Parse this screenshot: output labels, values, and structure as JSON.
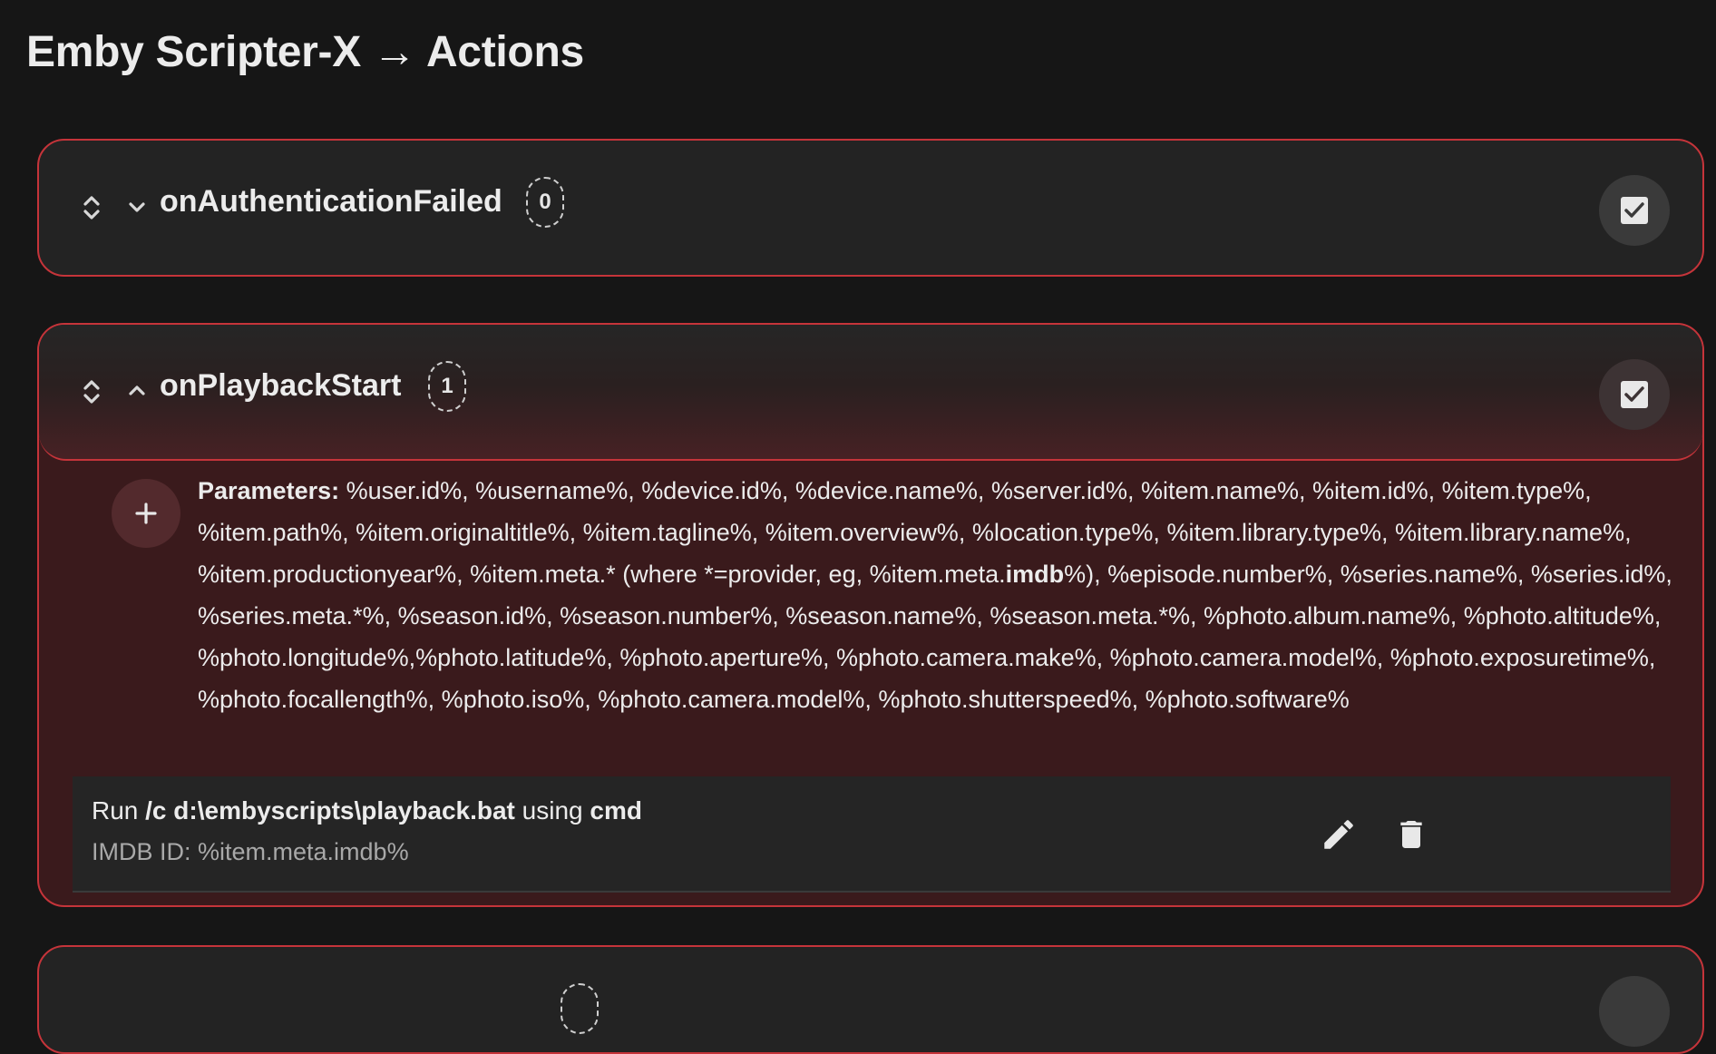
{
  "page": {
    "title": "Emby Scripter-X → Actions"
  },
  "events": [
    {
      "name": "onAuthenticationFailed",
      "count": "0",
      "expanded": false,
      "enabled": true
    },
    {
      "name": "onPlaybackStart",
      "count": "1",
      "expanded": true,
      "enabled": true,
      "parameters_label": "Parameters:",
      "parameters_text_a": " %user.id%, %username%, %device.id%, %device.name%, %server.id%, %item.name%, %item.id%, %item.type%, %item.path%, %item.originaltitle%, %item.tagline%, %item.overview%, %location.type%, %item.library.type%, %item.library.name%, %item.productionyear%, %item.meta.* (where *=provider, eg, %item.meta.",
      "parameters_bold": "imdb",
      "parameters_text_b": "%), %episode.number%, %series.name%, %series.id%, %series.meta.*%, %season.id%, %season.number%, %season.name%, %season.meta.*%, %photo.album.name%, %photo.altitude%, %photo.longitude%,%photo.latitude%, %photo.aperture%, %photo.camera.make%, %photo.camera.model%, %photo.exposuretime%, %photo.focallength%, %photo.iso%, %photo.camera.model%, %photo.shutterspeed%, %photo.software%",
      "actions": [
        {
          "run_prefix": "Run ",
          "command": "/c d:\\embyscripts\\playback.bat",
          "using_word": " using ",
          "interpreter": "cmd",
          "description": "IMDB ID: %item.meta.imdb%"
        }
      ]
    }
  ],
  "colors": {
    "accent": "#c5343a",
    "background": "#161616",
    "panel": "#232323",
    "expanded_panel": "#3a1a1c"
  },
  "icons": [
    "reorder-icon",
    "chevron-down-icon",
    "chevron-up-icon",
    "checkbox-checked-icon",
    "plus-icon",
    "pencil-icon",
    "trash-icon"
  ]
}
